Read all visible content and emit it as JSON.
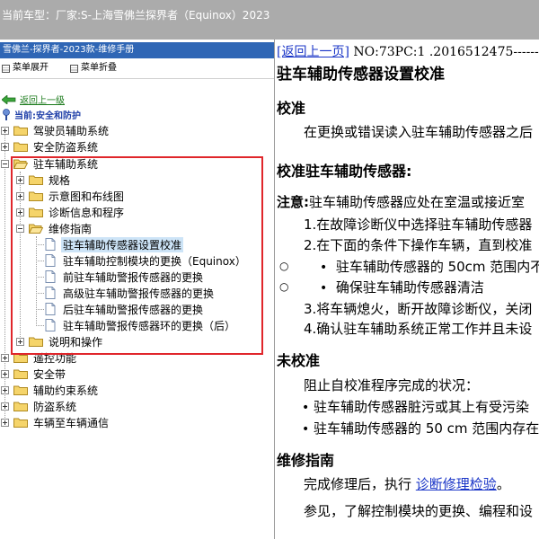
{
  "header": {
    "vehicle": "当前车型：厂家:S-上海雪佛兰探界者（Equinox）2023"
  },
  "left_pane": {
    "title": "雪佛兰-探界者-2023款-维修手册",
    "toolbar": {
      "expand": "菜单展开",
      "collapse": "菜单折叠"
    },
    "back": "返回上一级",
    "current": "当前:安全和防护",
    "tree": {
      "driver_assist": "驾驶员辅助系统",
      "safety_security": "安全防盗系统",
      "park_assist": "驻车辅助系统",
      "specs": "规格",
      "diagrams": "示意图和布线图",
      "diagnostics": "诊断信息和程序",
      "repair": "维修指南",
      "docs": [
        "驻车辅助传感器设置校准",
        "驻车辅助控制模块的更换（Equinox）",
        "前驻车辅助警报传感器的更换",
        "高级驻车辅助警报传感器的更换",
        "后驻车辅助警报传感器的更换",
        "驻车辅助警报传感器环的更换（后）"
      ],
      "description": "说明和操作",
      "remote": "遥控功能",
      "seatbelt": "安全带",
      "restraints": "辅助约束系统",
      "antitheft": "防盗系统",
      "v2v": "车辆至车辆通信"
    }
  },
  "content": {
    "back_link": "[返回上一页]",
    "doc_number": "NO:73PC:1 .2016512475-------",
    "title": "驻车辅助传感器设置校准",
    "section_calibration": "校准",
    "calibration_text": "在更换或错误读入驻车辅助传感器之后",
    "section_procedure": "校准驻车辅助传感器:",
    "note_label": "注意:",
    "note_text": "驻车辅助传感器应处在室温或接近室",
    "step1": "1.在故障诊断仪中选择驻车辅助传感器",
    "step2": "2.在下面的条件下操作车辆，直到校准",
    "cond1": "驻车辅助传感器的 50cm 范围内不",
    "cond2": "确保驻车辅助传感器清洁",
    "step3": "3.将车辆熄火，断开故障诊断仪，关闭",
    "step4": "4.确认驻车辅助系统正常工作并且未设",
    "section_uncalibrated": "未校准",
    "uncal_text": "阻止自校准程序完成的状况：",
    "uncal1": "驻车辅助传感器脏污或其上有受污染",
    "uncal2": "驻车辅助传感器的 50 cm 范围内存在",
    "section_repair": "维修指南",
    "repair_prefix": "完成修理后，执行",
    "repair_link": "诊断修理检验",
    "repair_suffix": "。",
    "see_also": "参见，了解控制模块的更换、编程和设"
  }
}
